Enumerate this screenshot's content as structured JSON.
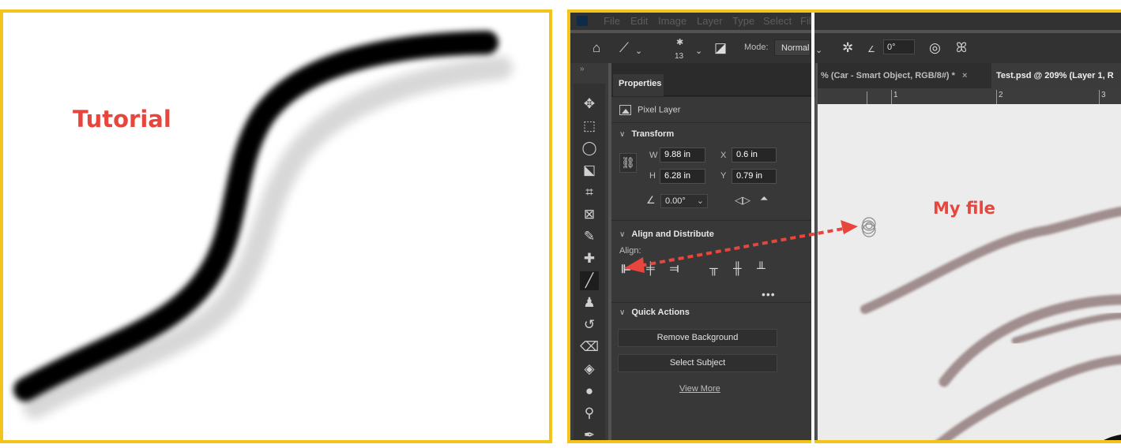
{
  "tutorial": {
    "label": "Tutorial"
  },
  "menu": [
    "File",
    "Edit",
    "Image",
    "Layer",
    "Type",
    "Select",
    "Filt"
  ],
  "options_bar": {
    "brush_size": "13",
    "mode_label": "Mode:",
    "mode_value": "Normal",
    "angle_value": "0°"
  },
  "properties": {
    "tab_label": "Properties",
    "layer_type": "Pixel Layer",
    "transform": {
      "title": "Transform",
      "w_label": "W",
      "w_value": "9.88 in",
      "h_label": "H",
      "h_value": "6.28 in",
      "x_label": "X",
      "x_value": "0.6 in",
      "y_label": "Y",
      "y_value": "0.79 in",
      "angle_value": "0.00°"
    },
    "align": {
      "title": "Align and Distribute",
      "label": "Align:"
    },
    "quick_actions": {
      "title": "Quick Actions",
      "remove_bg": "Remove Background",
      "select_subject": "Select Subject",
      "view_more": "View More"
    }
  },
  "documents": {
    "tab1": "% (Car - Smart Object, RGB/8#) *",
    "tab1_close": "×",
    "tab2": "Test.psd @ 209% (Layer 1, R"
  },
  "ruler": [
    "1",
    "2",
    "3"
  ],
  "canvas": {
    "label": "My file"
  },
  "colors": {
    "frame": "#f2c31b",
    "annotation": "#e8453c",
    "stroke_tutorial": "#000000",
    "stroke_tutorial_shadow": "#d9d9d9",
    "stroke_myfile": "#a08d8d"
  }
}
